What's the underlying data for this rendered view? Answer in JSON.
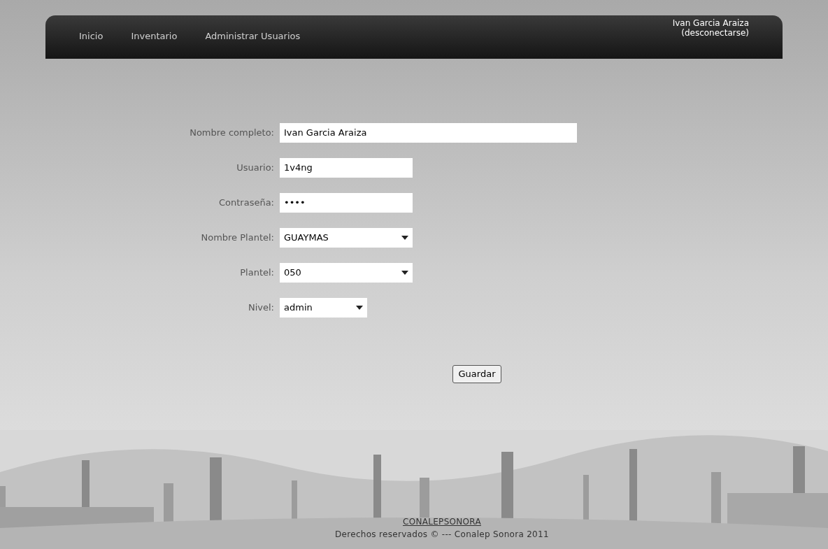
{
  "nav": {
    "items": [
      {
        "label": "Inicio"
      },
      {
        "label": "Inventario"
      },
      {
        "label": "Administrar Usuarios"
      }
    ],
    "user": {
      "name": "Ivan Garcia Araiza",
      "logout": "(desconectarse)"
    }
  },
  "form": {
    "fields": [
      {
        "kind": "text",
        "label": "Nombre completo:",
        "value": "Ivan Garcia Araiza"
      },
      {
        "kind": "text",
        "label": "Usuario:",
        "value": "1v4ng"
      },
      {
        "kind": "password",
        "label": "Contraseña:",
        "value": "••••"
      },
      {
        "kind": "select",
        "label": "Nombre Plantel:",
        "value": "GUAYMAS"
      },
      {
        "kind": "select",
        "label": "Plantel:",
        "value": "050"
      },
      {
        "kind": "select",
        "label": "Nivel:",
        "value": "admin"
      }
    ],
    "submit": "Guardar"
  },
  "footer": {
    "link": "CONALEPSONORA",
    "copyright": "Derechos reservados © --- Conalep Sonora 2011"
  }
}
